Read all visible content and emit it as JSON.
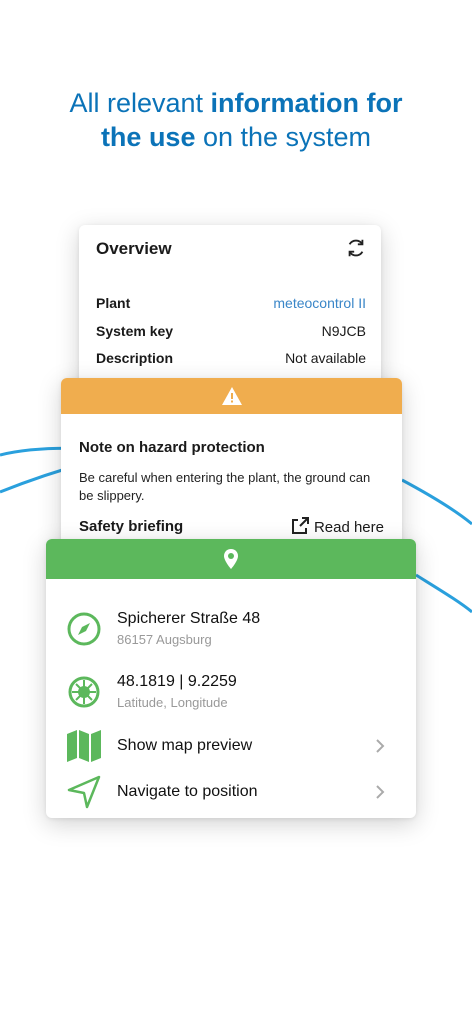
{
  "headline": {
    "part1": "All relevant ",
    "bold1": "information for",
    "bold2": "the use",
    "part2": " on the system"
  },
  "overview": {
    "title": "Overview",
    "refresh_icon": "refresh-icon",
    "rows": [
      {
        "label": "Plant",
        "value": "meteocontrol II"
      },
      {
        "label": "System key",
        "value": "N9JCB"
      },
      {
        "label": "Description",
        "value": "Not available"
      }
    ]
  },
  "hazard": {
    "header_icon": "warning-icon",
    "title": "Note on hazard protection",
    "text": "Be careful when entering the plant, the ground can be slippery.",
    "safety_label": "Safety briefing",
    "read_here": "Read here",
    "colors": {
      "header": "#f0ad4e"
    }
  },
  "location": {
    "header_icon": "location-pin-icon",
    "address_street": "Spicherer Straße 48",
    "address_city": "86157 Augsburg",
    "coordinates": "48.1819 | 9.2259",
    "coordinates_label": "Latitude, Longitude",
    "map_preview": "Show map preview",
    "navigate": "Navigate to position",
    "colors": {
      "header": "#5cb85c",
      "icon": "#5cb85c"
    }
  },
  "colors": {
    "accent": "#0b73b8",
    "link": "#3a86c8"
  }
}
